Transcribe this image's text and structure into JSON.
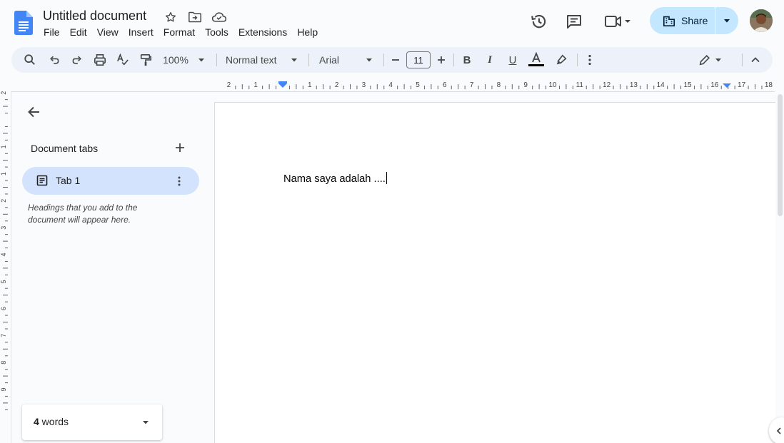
{
  "title_bar": {
    "doc_title": "Untitled document",
    "menus": [
      "File",
      "Edit",
      "View",
      "Insert",
      "Format",
      "Tools",
      "Extensions",
      "Help"
    ],
    "share_label": "Share"
  },
  "toolbar": {
    "zoom": "100%",
    "style": "Normal text",
    "font": "Arial",
    "font_size": "11"
  },
  "sidebar": {
    "section_title": "Document tabs",
    "tab_label": "Tab 1",
    "hint": "Headings that you add to the document will appear here.",
    "word_count_number": "4",
    "word_count_label": " words"
  },
  "document": {
    "text": "Nama saya adalah ...."
  },
  "ruler": {
    "h_labels": [
      "2",
      "1",
      "1",
      "2",
      "3",
      "4",
      "5",
      "6",
      "7",
      "8",
      "9",
      "10",
      "11",
      "12",
      "13",
      "14",
      "15",
      "16",
      "17",
      "18"
    ],
    "v_labels": [
      "2",
      "1",
      "1",
      "2",
      "3",
      "4",
      "5",
      "6",
      "7",
      "8",
      "9"
    ]
  },
  "colors": {
    "accent": "#0b57d0",
    "share_bg": "#c2e7ff",
    "toolbar_bg": "#edf2fa",
    "tab_selected": "#d3e3fd",
    "docs_blue": "#4285f4"
  }
}
